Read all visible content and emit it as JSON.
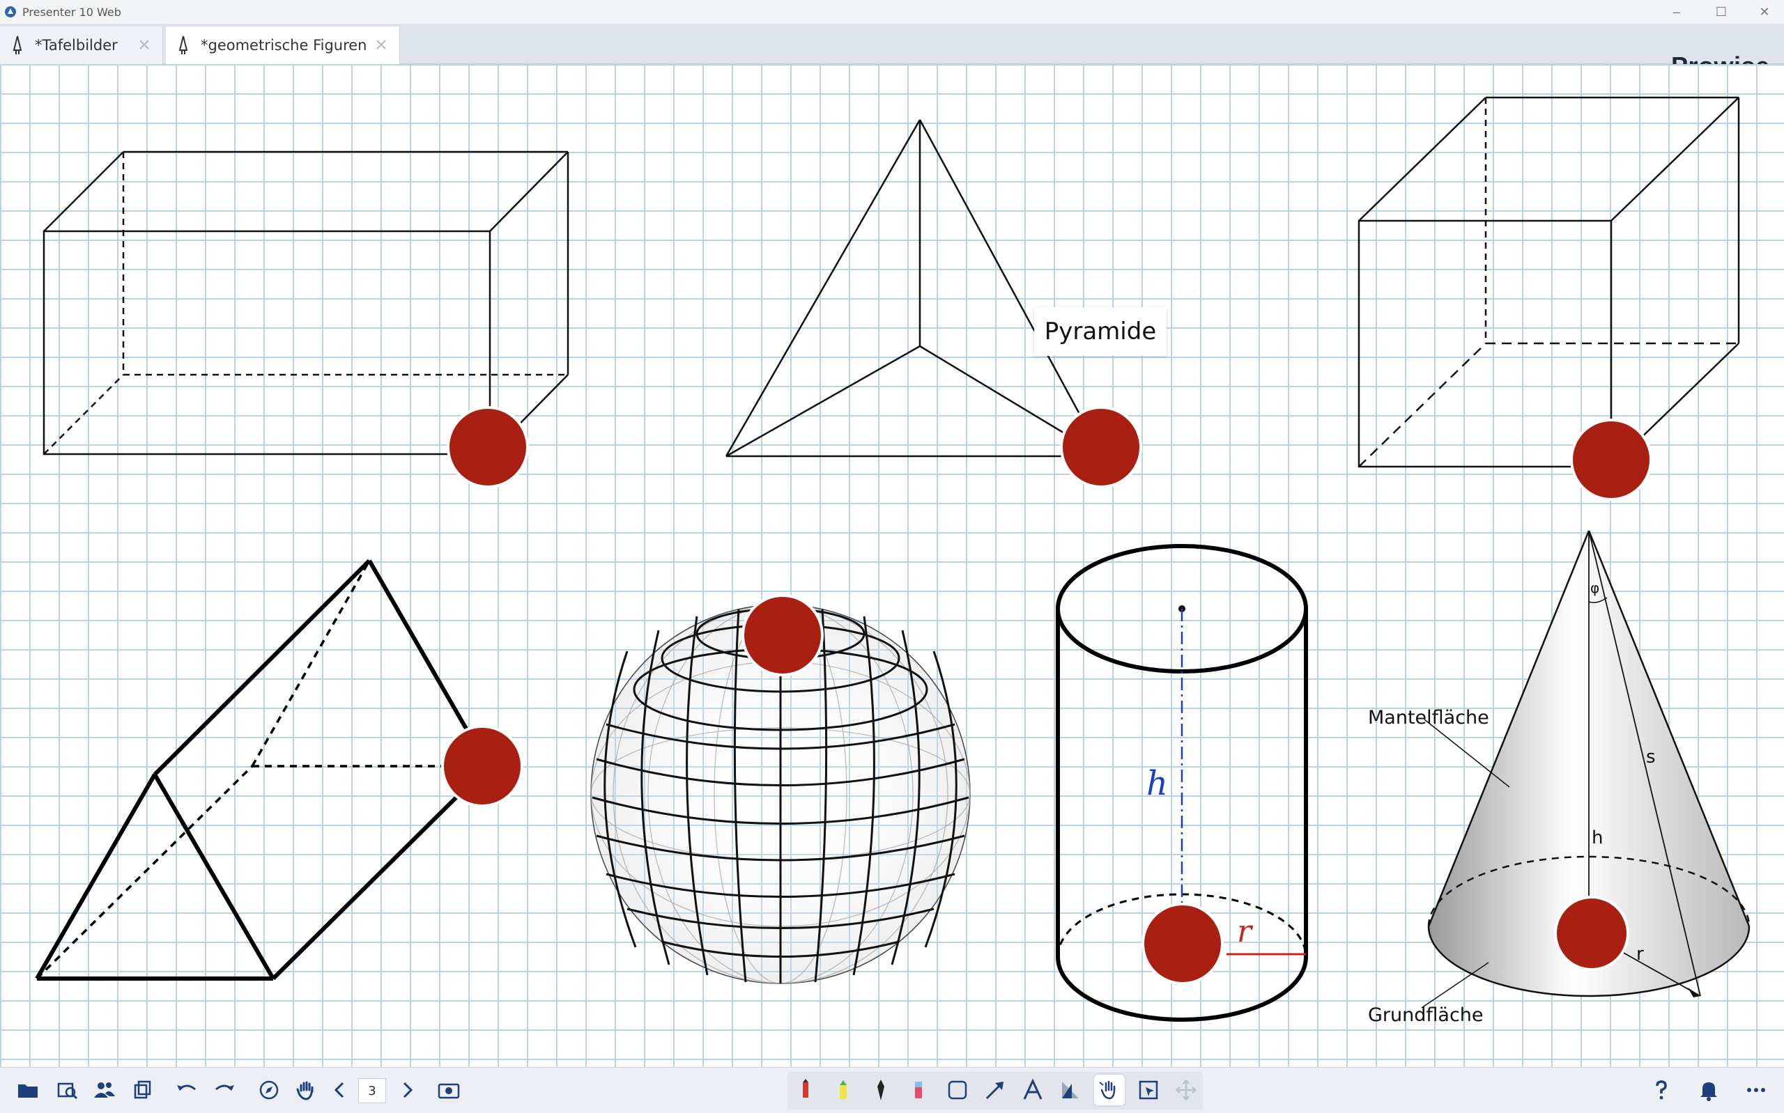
{
  "window": {
    "title": "Presenter 10 Web",
    "controls": {
      "minimize": "–",
      "maximize": "☐",
      "close": "✕"
    }
  },
  "tabs": [
    {
      "label": "*Tafelbilder",
      "active": false
    },
    {
      "label": "*geometrische Figuren",
      "active": true
    }
  ],
  "brand": {
    "logo_text": "Prowise"
  },
  "canvas": {
    "grid_color": "#b9d3e4",
    "dot_color": "#a91f12",
    "labels": {
      "pyramid": "Pyramide",
      "cone_lateral": "Mantelfläche",
      "cone_base": "Grundfläche",
      "cone_h": "h",
      "cone_s": "s",
      "cone_r": "r",
      "cone_phi": "φ",
      "cylinder_h": "h",
      "cylinder_r": "r"
    }
  },
  "toolbar": {
    "page_number": "3",
    "icons": [
      "folder-icon",
      "image-search-icon",
      "users-icon",
      "copy-pages-icon",
      "undo-icon",
      "redo-icon",
      "compass-icon",
      "hand-pan-icon",
      "previous-page-icon",
      "next-page-icon",
      "camera-icon",
      "red-pen-icon",
      "highlighter-icon",
      "fountain-pen-icon",
      "eraser-icon",
      "shape-icon",
      "arrow-icon",
      "text-icon",
      "geometry-icon",
      "hand-select-icon",
      "selection-frame-icon",
      "move-icon",
      "help-icon",
      "bell-icon",
      "more-icon"
    ],
    "accent": "#1f3f7a"
  }
}
